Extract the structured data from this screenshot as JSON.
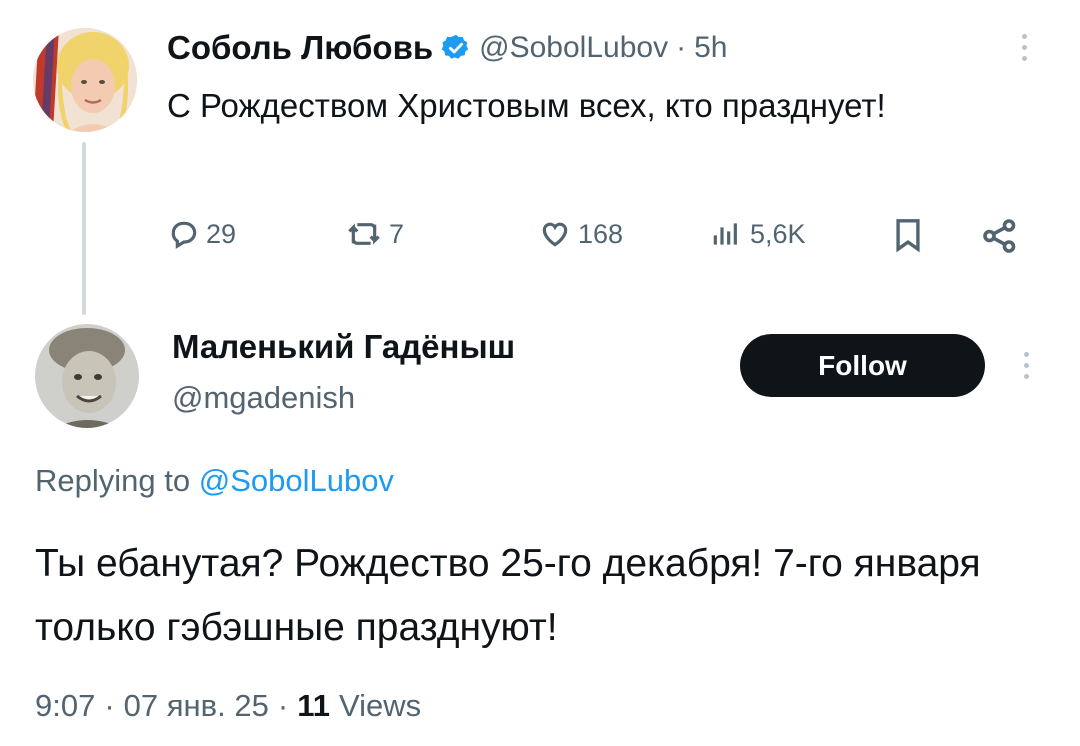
{
  "original_tweet": {
    "author_name": "Соболь Любовь",
    "handle": "@SobolLubov",
    "separator": "·",
    "time": "5h",
    "text": "С Рождеством Христовым всех, кто празднует!",
    "verified_icon": "verified-badge-icon",
    "actions": {
      "replies": "29",
      "retweets": "7",
      "likes": "168",
      "views": "5,6K"
    }
  },
  "reply_tweet": {
    "author_name": "Маленький Гадёныш",
    "handle": "@mgadenish",
    "follow_label": "Follow",
    "replying_prefix": "Replying to",
    "replying_handle": "@SobolLubov",
    "text": "Ты ебанутая? Рождество 25-го декабря! 7-го января только гэбэшные празднуют!",
    "meta_time": "9:07",
    "meta_sep1": "·",
    "meta_date": "07 янв. 25",
    "meta_sep2": "·",
    "views_count": "11",
    "views_label": "Views"
  },
  "colors": {
    "accent": "#1d9bf0",
    "muted": "#536471",
    "text": "#0f1419",
    "thread_line": "#cfd9de"
  }
}
